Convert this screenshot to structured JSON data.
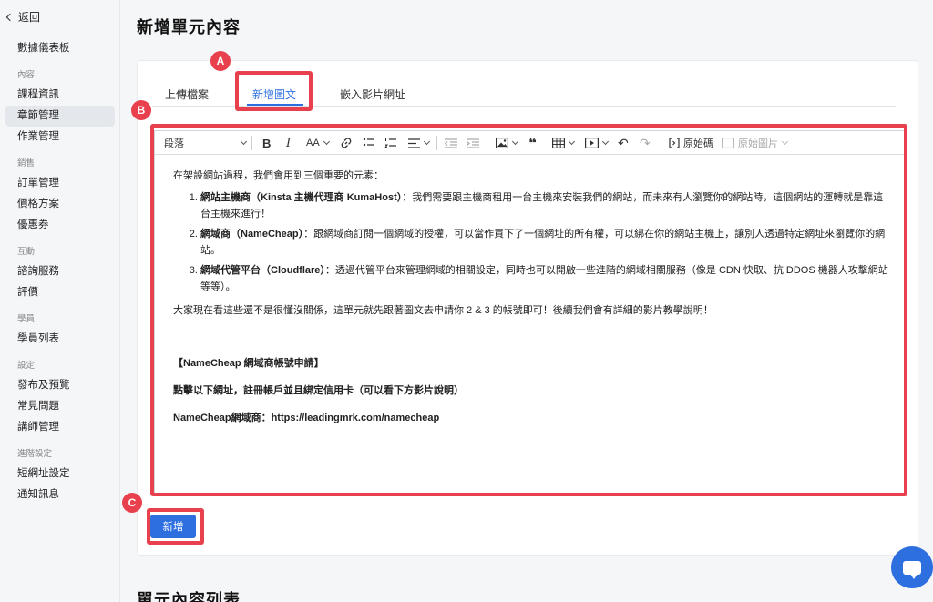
{
  "sidebar": {
    "back": "返回",
    "dashboard": "數據儀表板",
    "groups": [
      {
        "title": "內容",
        "items": [
          "課程資訊",
          "章節管理",
          "作業管理"
        ]
      },
      {
        "title": "銷售",
        "items": [
          "訂單管理",
          "價格方案",
          "優惠券"
        ]
      },
      {
        "title": "互動",
        "items": [
          "諮詢服務",
          "評價"
        ]
      },
      {
        "title": "學員",
        "items": [
          "學員列表"
        ]
      },
      {
        "title": "設定",
        "items": [
          "發布及預覽",
          "常見問題",
          "講師管理"
        ]
      },
      {
        "title": "進階設定",
        "items": [
          "短網址設定",
          "通知訊息"
        ]
      }
    ],
    "active": "章節管理"
  },
  "header": {
    "title": "新增單元內容"
  },
  "tabs": [
    "上傳檔案",
    "新增圖文",
    "嵌入影片網址"
  ],
  "toolbar": {
    "paragraph": "段落",
    "source": "原始碼",
    "source_image": "原始圖片"
  },
  "content": {
    "intro": "在架設網站過程，我們會用到三個重要的元素：",
    "items": [
      {
        "strong": "網站主機商（Kinsta 主機代理商 KumaHost）",
        "text": "：我們需要跟主機商租用一台主機來安裝我們的網站，而未來有人瀏覽你的網站時，這個網站的運轉就是靠這台主機來進行！"
      },
      {
        "strong": "網域商（NameCheap）",
        "text": "：跟網域商訂閱一個網域的授權，可以當作買下了一個網址的所有權，可以綁在你的網站主機上，讓別人透過特定網址來瀏覽你的網站。"
      },
      {
        "strong": "網域代管平台（Cloudflare）",
        "text": "：透過代管平台來管理網域的相關設定，同時也可以開啟一些進階的網域相關服務（像是 CDN 快取、抗 DDOS 機器人攻擊網站等等）。"
      }
    ],
    "outro": "大家現在看這些還不是很懂沒關係，這單元就先跟著圖文去申請你 2 & 3 的帳號即可！後續我們會有詳細的影片教學說明！",
    "heading": "【NameCheap 網域商帳號申請】",
    "instruction": "點擊以下網址，註冊帳戶並且綁定信用卡（可以看下方影片說明）",
    "link_line": "NameCheap網域商：https://leadingmrk.com/namecheap"
  },
  "add_button": "新增",
  "annotations": {
    "a": "A",
    "b": "B",
    "c": "C"
  },
  "list_title": "單元內容列表",
  "colors": {
    "accent": "#2e6fe0",
    "highlight": "#e8404c"
  }
}
